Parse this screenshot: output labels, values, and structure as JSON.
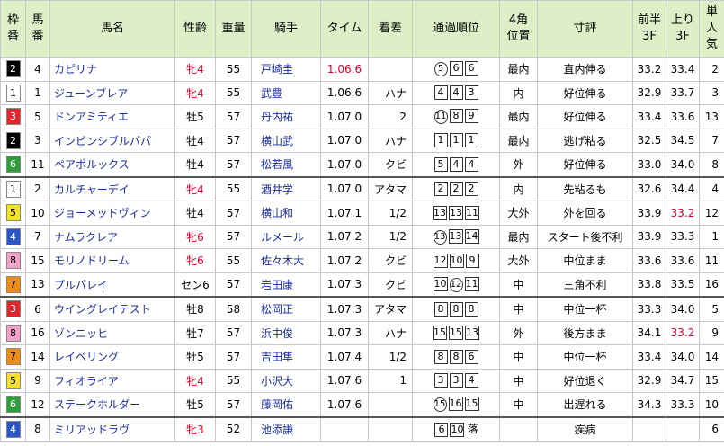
{
  "headers": [
    "枠番",
    "馬番",
    "馬名",
    "性齢",
    "重量",
    "騎手",
    "タイム",
    "着差",
    "通過順位",
    "4角位置",
    "寸評",
    "前半3F",
    "上り3F",
    "単人気"
  ],
  "rows": [
    {
      "waku": "2",
      "umaban": "4",
      "name": "カピリナ",
      "sexage": "牝4",
      "weight": "55",
      "jockey": "戸崎圭",
      "time": "1.06.6",
      "margin": "",
      "passing": [
        {
          "v": "5",
          "t": "circle"
        },
        {
          "v": "6",
          "t": "box"
        },
        {
          "v": "6",
          "t": "box"
        }
      ],
      "corner": "最内",
      "comment": "直内伸る",
      "first3f": "33.2",
      "last3f": "33.4",
      "pop": "2",
      "red_sexage": true,
      "red_time": true,
      "red_last": false
    },
    {
      "waku": "1",
      "umaban": "1",
      "name": "ジューンブレア",
      "sexage": "牝4",
      "weight": "55",
      "jockey": "武豊",
      "time": "1.06.6",
      "margin": "ハナ",
      "passing": [
        {
          "v": "4",
          "t": "box"
        },
        {
          "v": "4",
          "t": "box"
        },
        {
          "v": "3",
          "t": "box"
        }
      ],
      "corner": "内",
      "comment": "好位伸る",
      "first3f": "32.9",
      "last3f": "33.7",
      "pop": "3",
      "red_sexage": true,
      "red_time": false,
      "red_last": false
    },
    {
      "waku": "3",
      "umaban": "5",
      "name": "ドンアミティエ",
      "sexage": "牡5",
      "weight": "57",
      "jockey": "丹内祐",
      "time": "1.07.0",
      "margin": "2",
      "passing": [
        {
          "v": "11",
          "t": "circle"
        },
        {
          "v": "8",
          "t": "box"
        },
        {
          "v": "9",
          "t": "box"
        }
      ],
      "corner": "最内",
      "comment": "好位伸る",
      "first3f": "33.4",
      "last3f": "33.6",
      "pop": "13",
      "red_sexage": false,
      "red_time": false,
      "red_last": false
    },
    {
      "waku": "2",
      "umaban": "3",
      "name": "インビンシブルパパ",
      "sexage": "牡4",
      "weight": "57",
      "jockey": "横山武",
      "time": "1.07.0",
      "margin": "ハナ",
      "passing": [
        {
          "v": "1",
          "t": "box"
        },
        {
          "v": "1",
          "t": "box"
        },
        {
          "v": "1",
          "t": "box"
        }
      ],
      "corner": "最内",
      "comment": "逃げ粘る",
      "first3f": "32.5",
      "last3f": "34.5",
      "pop": "7",
      "red_sexage": false,
      "red_time": false,
      "red_last": false
    },
    {
      "waku": "6",
      "umaban": "11",
      "name": "ペアポルックス",
      "sexage": "牡4",
      "weight": "57",
      "jockey": "松若風",
      "time": "1.07.0",
      "margin": "クビ",
      "passing": [
        {
          "v": "5",
          "t": "box"
        },
        {
          "v": "4",
          "t": "box"
        },
        {
          "v": "4",
          "t": "box"
        }
      ],
      "corner": "外",
      "comment": "好位伸る",
      "first3f": "33.0",
      "last3f": "34.0",
      "pop": "8",
      "red_sexage": false,
      "red_time": false,
      "red_last": false,
      "sep": true
    },
    {
      "waku": "1",
      "umaban": "2",
      "name": "カルチャーデイ",
      "sexage": "牝4",
      "weight": "55",
      "jockey": "酒井学",
      "time": "1.07.0",
      "margin": "アタマ",
      "passing": [
        {
          "v": "2",
          "t": "box"
        },
        {
          "v": "2",
          "t": "box"
        },
        {
          "v": "2",
          "t": "box"
        }
      ],
      "corner": "内",
      "comment": "先粘るも",
      "first3f": "32.6",
      "last3f": "34.4",
      "pop": "4",
      "red_sexage": true,
      "red_time": false,
      "red_last": false
    },
    {
      "waku": "5",
      "umaban": "10",
      "name": "ジョーメッドヴィン",
      "sexage": "牡4",
      "weight": "57",
      "jockey": "横山和",
      "time": "1.07.1",
      "margin": "1/2",
      "passing": [
        {
          "v": "13",
          "t": "box"
        },
        {
          "v": "13",
          "t": "box"
        },
        {
          "v": "11",
          "t": "box"
        }
      ],
      "corner": "大外",
      "comment": "外を回る",
      "first3f": "33.9",
      "last3f": "33.2",
      "pop": "12",
      "red_sexage": false,
      "red_time": false,
      "red_last": true
    },
    {
      "waku": "4",
      "umaban": "7",
      "name": "ナムラクレア",
      "sexage": "牝6",
      "weight": "57",
      "jockey": "ルメール",
      "time": "1.07.2",
      "margin": "1/2",
      "passing": [
        {
          "v": "13",
          "t": "circle"
        },
        {
          "v": "13",
          "t": "box"
        },
        {
          "v": "14",
          "t": "box"
        }
      ],
      "corner": "最内",
      "comment": "スタート後不利",
      "first3f": "33.9",
      "last3f": "33.3",
      "pop": "1",
      "red_sexage": true,
      "red_time": false,
      "red_last": false
    },
    {
      "waku": "8",
      "umaban": "15",
      "name": "モリノドリーム",
      "sexage": "牝6",
      "weight": "55",
      "jockey": "佐々木大",
      "time": "1.07.2",
      "margin": "クビ",
      "passing": [
        {
          "v": "12",
          "t": "box"
        },
        {
          "v": "10",
          "t": "box"
        },
        {
          "v": "9",
          "t": "box"
        }
      ],
      "corner": "大外",
      "comment": "中位まま",
      "first3f": "33.6",
      "last3f": "33.6",
      "pop": "11",
      "red_sexage": true,
      "red_time": false,
      "red_last": false
    },
    {
      "waku": "7",
      "umaban": "13",
      "name": "プルパレイ",
      "sexage": "セン6",
      "weight": "57",
      "jockey": "岩田康",
      "time": "1.07.3",
      "margin": "クビ",
      "passing": [
        {
          "v": "10",
          "t": "box"
        },
        {
          "v": "12",
          "t": "circle"
        },
        {
          "v": "11",
          "t": "box"
        }
      ],
      "corner": "中",
      "comment": "三角不利",
      "first3f": "33.8",
      "last3f": "33.5",
      "pop": "16",
      "red_sexage": false,
      "red_time": false,
      "red_last": false,
      "sep": true
    },
    {
      "waku": "3",
      "umaban": "6",
      "name": "ウイングレイテスト",
      "sexage": "牡8",
      "weight": "58",
      "jockey": "松岡正",
      "time": "1.07.3",
      "margin": "アタマ",
      "passing": [
        {
          "v": "8",
          "t": "box"
        },
        {
          "v": "8",
          "t": "box"
        },
        {
          "v": "8",
          "t": "box"
        }
      ],
      "corner": "中",
      "comment": "中位一杯",
      "first3f": "33.3",
      "last3f": "34.0",
      "pop": "5",
      "red_sexage": false,
      "red_time": false,
      "red_last": false
    },
    {
      "waku": "8",
      "umaban": "16",
      "name": "ゾンニッヒ",
      "sexage": "牡7",
      "weight": "57",
      "jockey": "浜中俊",
      "time": "1.07.3",
      "margin": "ハナ",
      "passing": [
        {
          "v": "15",
          "t": "box"
        },
        {
          "v": "15",
          "t": "box"
        },
        {
          "v": "13",
          "t": "box"
        }
      ],
      "corner": "外",
      "comment": "後方まま",
      "first3f": "34.1",
      "last3f": "33.2",
      "pop": "9",
      "red_sexage": false,
      "red_time": false,
      "red_last": true
    },
    {
      "waku": "7",
      "umaban": "14",
      "name": "レイベリング",
      "sexage": "牡5",
      "weight": "57",
      "jockey": "吉田隼",
      "time": "1.07.4",
      "margin": "1/2",
      "passing": [
        {
          "v": "8",
          "t": "box"
        },
        {
          "v": "8",
          "t": "box"
        },
        {
          "v": "6",
          "t": "box"
        }
      ],
      "corner": "中",
      "comment": "中位一杯",
      "first3f": "33.4",
      "last3f": "34.0",
      "pop": "14",
      "red_sexage": false,
      "red_time": false,
      "red_last": false
    },
    {
      "waku": "5",
      "umaban": "9",
      "name": "フィオライア",
      "sexage": "牝4",
      "weight": "55",
      "jockey": "小沢大",
      "time": "1.07.6",
      "margin": "1",
      "passing": [
        {
          "v": "3",
          "t": "box"
        },
        {
          "v": "3",
          "t": "box"
        },
        {
          "v": "4",
          "t": "box"
        }
      ],
      "corner": "中",
      "comment": "好位退く",
      "first3f": "32.9",
      "last3f": "34.7",
      "pop": "15",
      "red_sexage": true,
      "red_time": false,
      "red_last": false
    },
    {
      "waku": "6",
      "umaban": "12",
      "name": "ステークホルダー",
      "sexage": "牡5",
      "weight": "57",
      "jockey": "藤岡佑",
      "time": "1.07.6",
      "margin": "",
      "passing": [
        {
          "v": "15",
          "t": "circle"
        },
        {
          "v": "16",
          "t": "box"
        },
        {
          "v": "15",
          "t": "box"
        }
      ],
      "corner": "中",
      "comment": "出遅れる",
      "first3f": "34.3",
      "last3f": "33.3",
      "pop": "10",
      "red_sexage": false,
      "red_time": false,
      "red_last": false,
      "sep": true
    },
    {
      "waku": "4",
      "umaban": "8",
      "name": "ミリアッドラヴ",
      "sexage": "牝3",
      "weight": "52",
      "jockey": "池添謙",
      "time": "",
      "margin": "",
      "passing": [
        {
          "v": "6",
          "t": "box"
        },
        {
          "v": "10",
          "t": "box"
        },
        {
          "v": "落",
          "t": "text"
        }
      ],
      "corner": "",
      "comment": "疾病",
      "first3f": "",
      "last3f": "",
      "pop": "6",
      "red_sexage": true,
      "red_time": false,
      "red_last": false
    }
  ]
}
